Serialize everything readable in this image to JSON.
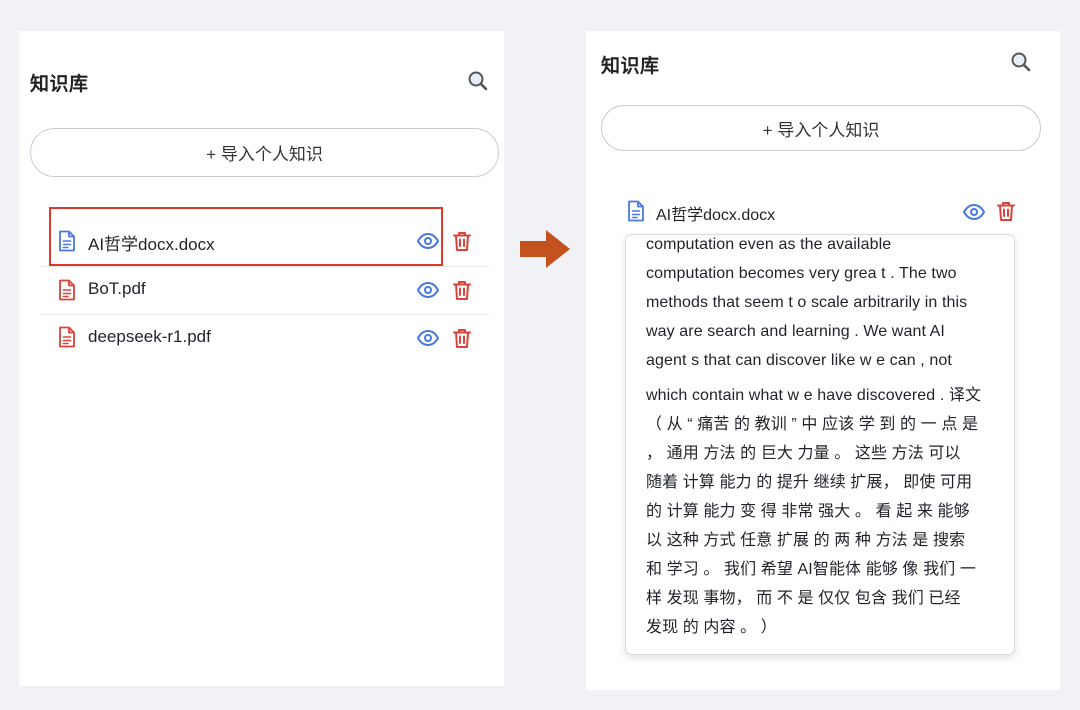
{
  "left_panel": {
    "title": "知识库",
    "search_icon": "search-icon",
    "import_button": "+ 导入个人知识",
    "files": [
      {
        "name": "AI哲学docx.docx",
        "icon": "document-icon",
        "color": "#4a78e0",
        "selected": true
      },
      {
        "name": "BoT.pdf",
        "icon": "document-icon",
        "color": "#d9433a",
        "selected": false
      },
      {
        "name": "deepseek-r1.pdf",
        "icon": "document-icon",
        "color": "#d9433a",
        "selected": false
      }
    ]
  },
  "right_panel": {
    "title": "知识库",
    "search_icon": "search-icon",
    "import_button": "+ 导入个人知识",
    "file": {
      "name": "AI哲学docx.docx",
      "icon": "document-icon",
      "color": "#4a78e0"
    },
    "preview_lines": [
      "computation even as the available",
      "computation becomes very grea t . The two",
      "methods that seem t o scale arbitrarily in this",
      "way are search and learning . We want AI",
      "agent s that can discover like w e can , not",
      "which contain what w e have discovered . 译文",
      "（ 从 “ 痛苦 的 教训 ” 中 应该 学 到 的 一 点 是",
      "， 通用 方法 的 巨大 力量 。 这些 方法 可以",
      "随着 计算 能力 的 提升 继续 扩展， 即使 可用",
      "的 计算 能力 变 得 非常 强大 。 看 起 来 能够",
      "以 这种 方式 任意 扩展 的 两 种 方法 是 搜索",
      "和 学习 。 我们 希望 AI智能体 能够 像 我们 一",
      "样 发现 事物， 而 不 是 仅仅 包含 我们 已经",
      "发现 的 内容 。 ）"
    ]
  },
  "colors": {
    "accent_blue": "#4a78e0",
    "danger_red": "#d9433a",
    "highlight_red": "#d93a2b",
    "arrow_orange": "#c4521e"
  },
  "icons": {
    "view": "eye-icon",
    "delete": "trash-icon",
    "transition": "arrow-right-icon"
  }
}
